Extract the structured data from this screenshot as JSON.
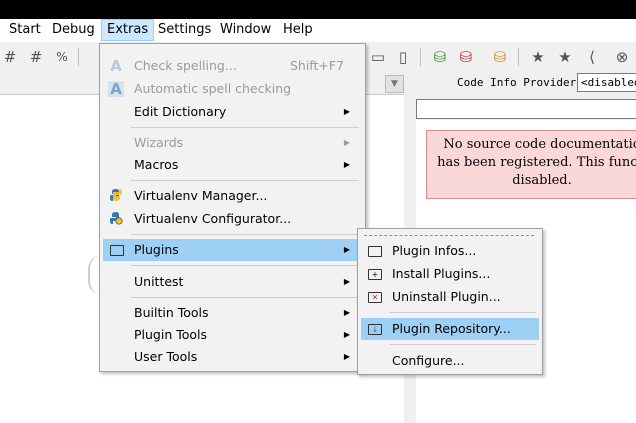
{
  "menubar": {
    "items": [
      "Start",
      "Debug",
      "Extras",
      "Settings",
      "Window",
      "Help"
    ],
    "active": "Extras"
  },
  "code_info": {
    "label": "Code Info Provider:",
    "value": "<disabled>",
    "message_line1": "No source code documentatio",
    "message_line2": "has been registered. This functi",
    "message_line3": "disabled."
  },
  "extras_menu": {
    "check_spelling": "Check spelling...",
    "check_spelling_shortcut": "Shift+F7",
    "auto_spell": "Automatic spell checking",
    "edit_dictionary": "Edit Dictionary",
    "wizards": "Wizards",
    "macros": "Macros",
    "venv_manager": "Virtualenv Manager...",
    "venv_configurator": "Virtualenv Configurator...",
    "plugins": "Plugins",
    "unittest": "Unittest",
    "builtin_tools": "Builtin Tools",
    "plugin_tools": "Plugin Tools",
    "user_tools": "User Tools"
  },
  "plugins_menu": {
    "infos": "Plugin Infos...",
    "install": "Install Plugins...",
    "uninstall": "Uninstall Plugin...",
    "repository": "Plugin Repository...",
    "configure": "Configure..."
  },
  "icons": {
    "accent_highlight": "#9ed0f6",
    "menubar_active": "#cce8ff",
    "doc_message_bg": "#fbd8d8"
  }
}
